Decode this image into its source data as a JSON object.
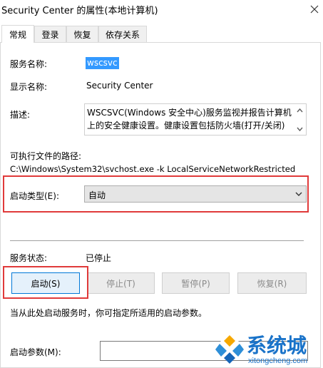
{
  "window": {
    "title": "Security Center 的属性(本地计算机)",
    "close_icon": "×"
  },
  "tabs": [
    {
      "label": "常规",
      "active": true
    },
    {
      "label": "登录",
      "active": false
    },
    {
      "label": "恢复",
      "active": false
    },
    {
      "label": "依存关系",
      "active": false
    }
  ],
  "general": {
    "service_name_label": "服务名称:",
    "service_name": "wscsvc",
    "display_name_label": "显示名称:",
    "display_name": "Security Center",
    "description_label": "描述:",
    "description": "WSCSVC(Windows 安全中心)服务监视并报告计算机上的安全健康设置。健康设置包括防火墙(打开/关闭)",
    "exe_path_label": "可执行文件的路径:",
    "exe_path": "C:\\Windows\\System32\\svchost.exe -k LocalServiceNetworkRestricted",
    "startup_type_label": "启动类型(E):",
    "startup_type": "自动",
    "service_status_label": "服务状态:",
    "service_status": "已停止",
    "buttons": {
      "start": "启动(S)",
      "stop": "停止(T)",
      "pause": "暂停(P)",
      "resume": "恢复(R)"
    },
    "hint": "当从此处启动服务时，你可指定所适用的启动参数。",
    "start_params_label": "启动参数(M):",
    "start_params_value": ""
  },
  "watermark": {
    "text": "系统城",
    "sub": "xitongcheng.com"
  },
  "colors": {
    "highlight": "#3399ff",
    "annotation_red": "#e03a3a",
    "watermark_blue": "#1a73c9"
  }
}
